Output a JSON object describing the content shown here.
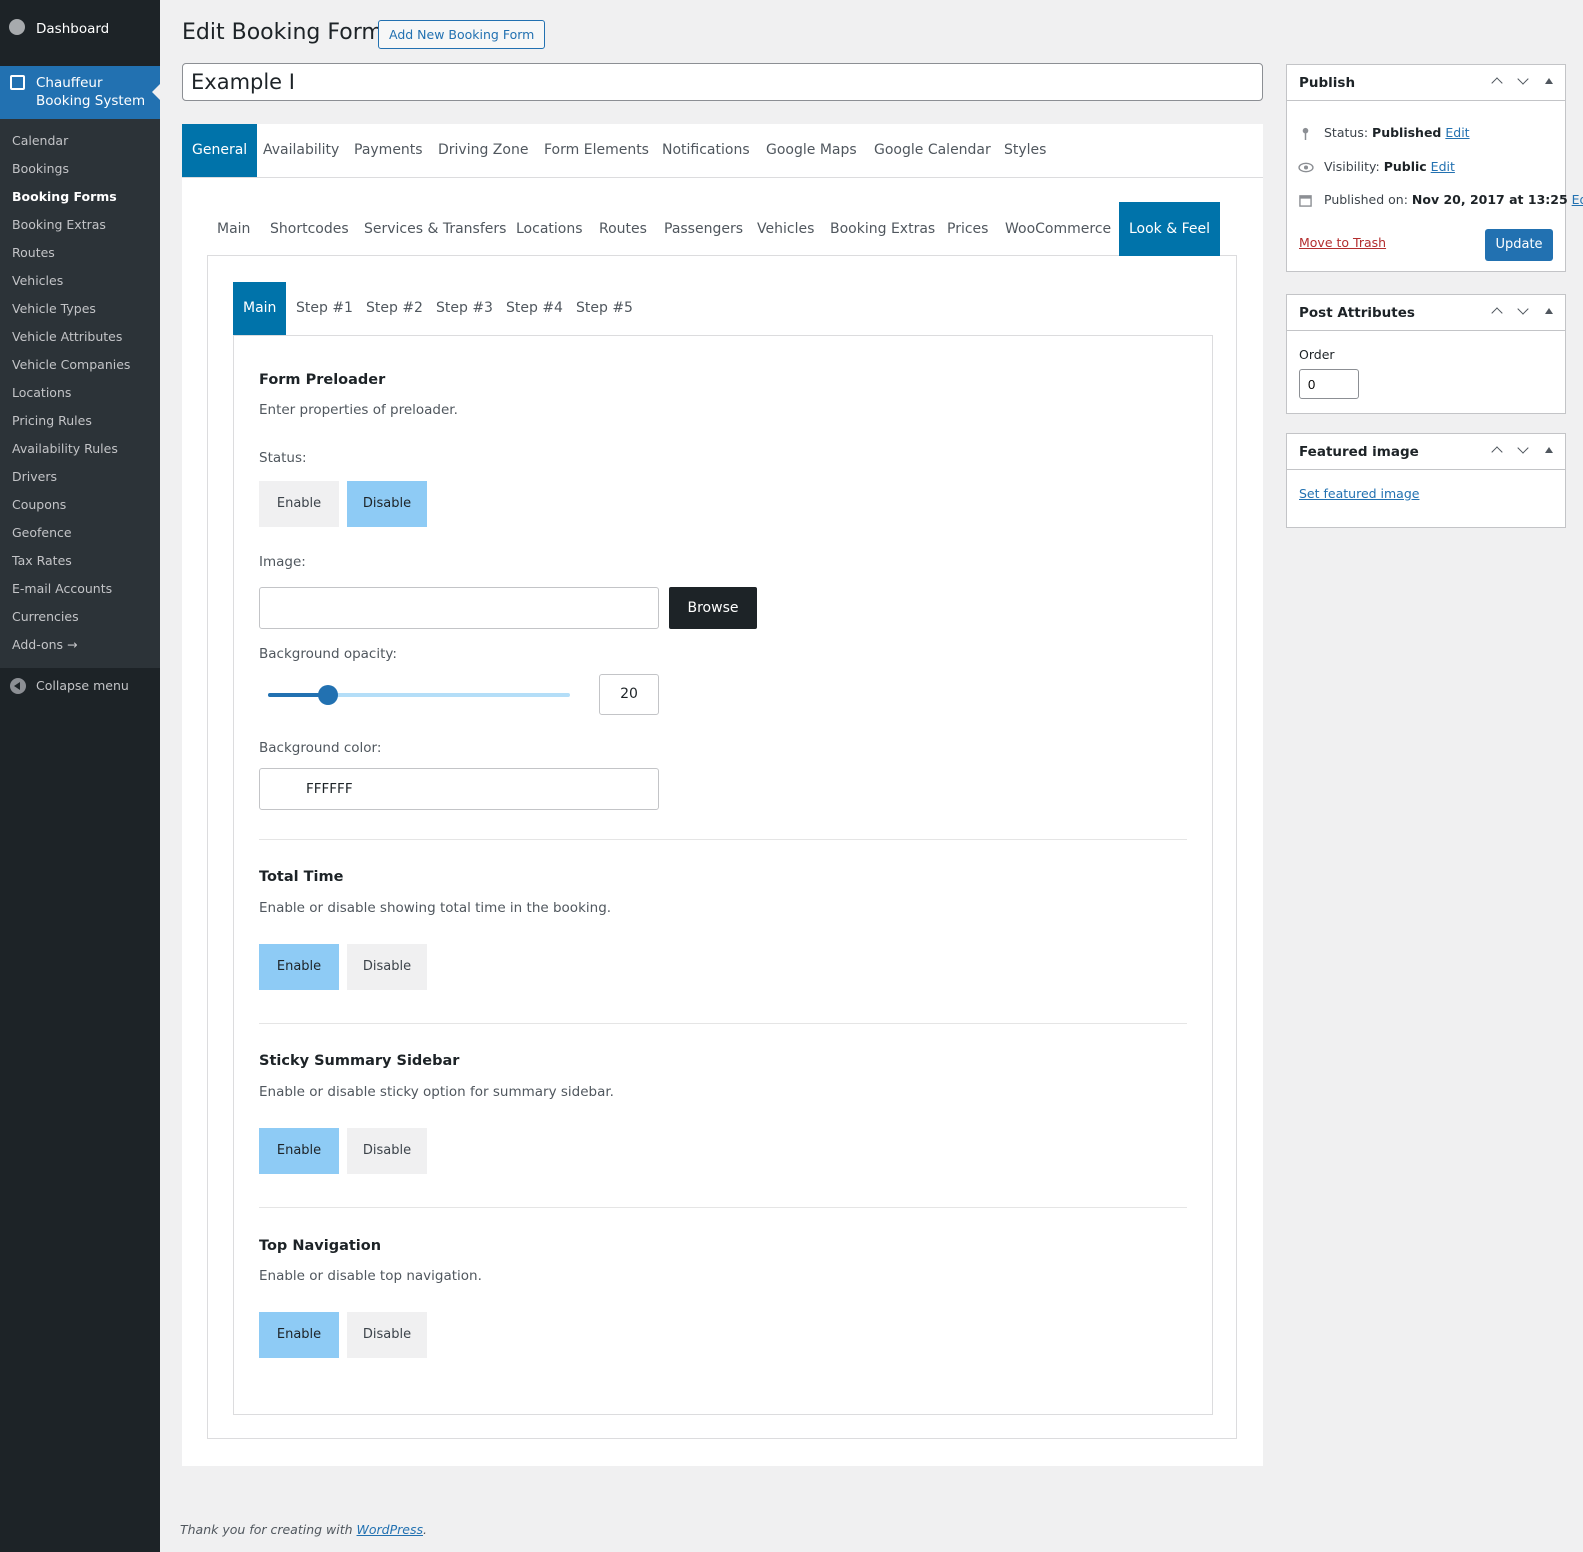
{
  "sidebar": {
    "dashboard": "Dashboard",
    "active_menu_line1": "Chauffeur",
    "active_menu_line2": "Booking System",
    "items": [
      "Calendar",
      "Bookings",
      "Booking Forms",
      "Booking Extras",
      "Routes",
      "Vehicles",
      "Vehicle Types",
      "Vehicle Attributes",
      "Vehicle Companies",
      "Locations",
      "Pricing Rules",
      "Availability Rules",
      "Drivers",
      "Coupons",
      "Geofence",
      "Tax Rates",
      "E-mail Accounts",
      "Currencies",
      "Add-ons →"
    ],
    "current_item": "Booking Forms",
    "collapse": "Collapse menu"
  },
  "header": {
    "title": "Edit Booking Form",
    "add_new": "Add New Booking Form",
    "post_title": "Example I"
  },
  "tabs_top": [
    "General",
    "Availability",
    "Payments",
    "Driving Zone",
    "Form Elements",
    "Notifications",
    "Google Maps",
    "Google Calendar",
    "Styles"
  ],
  "tabs_top_active": "General",
  "tabs_mid": [
    "Main",
    "Shortcodes",
    "Services & Transfers",
    "Locations",
    "Routes",
    "Passengers",
    "Vehicles",
    "Booking Extras",
    "Prices",
    "WooCommerce",
    "Look & Feel"
  ],
  "tabs_mid_active": "Look & Feel",
  "tabs_step": [
    "Main",
    "Step #1",
    "Step #2",
    "Step #3",
    "Step #4",
    "Step #5"
  ],
  "tabs_step_active": "Main",
  "preloader": {
    "title": "Form Preloader",
    "desc": "Enter properties of preloader.",
    "status_label": "Status:",
    "enable": "Enable",
    "disable": "Disable",
    "status_selected": "Disable",
    "image_label": "Image:",
    "image_value": "",
    "browse": "Browse",
    "opacity_label": "Background opacity:",
    "opacity_value": "20",
    "opacity_percent": 20,
    "color_label": "Background color:",
    "color_value": "FFFFFF"
  },
  "total_time": {
    "title": "Total Time",
    "desc": "Enable or disable showing total time in the booking.",
    "enable": "Enable",
    "disable": "Disable",
    "selected": "Enable"
  },
  "sticky": {
    "title": "Sticky Summary Sidebar",
    "desc": "Enable or disable sticky option for summary sidebar.",
    "enable": "Enable",
    "disable": "Disable",
    "selected": "Enable"
  },
  "topnav": {
    "title": "Top Navigation",
    "desc": "Enable or disable top navigation.",
    "enable": "Enable",
    "disable": "Disable",
    "selected": "Enable"
  },
  "publish": {
    "title": "Publish",
    "status_label": "Status:",
    "status_value": "Published",
    "visibility_label": "Visibility:",
    "visibility_value": "Public",
    "published_label": "Published on:",
    "published_value": "Nov 20, 2017 at 13:25",
    "edit": "Edit",
    "trash": "Move to Trash",
    "update": "Update"
  },
  "attributes": {
    "title": "Post Attributes",
    "order_label": "Order",
    "order_value": "0"
  },
  "featured": {
    "title": "Featured image",
    "link": "Set featured image"
  },
  "footer": {
    "text": "Thank you for creating with",
    "link": "WordPress",
    "end": "."
  },
  "colors": {
    "admin_bar": "#1d2327",
    "accent": "#2271b1",
    "tab_active": "#0073aa",
    "toggle_on": "#8ecbf5"
  }
}
